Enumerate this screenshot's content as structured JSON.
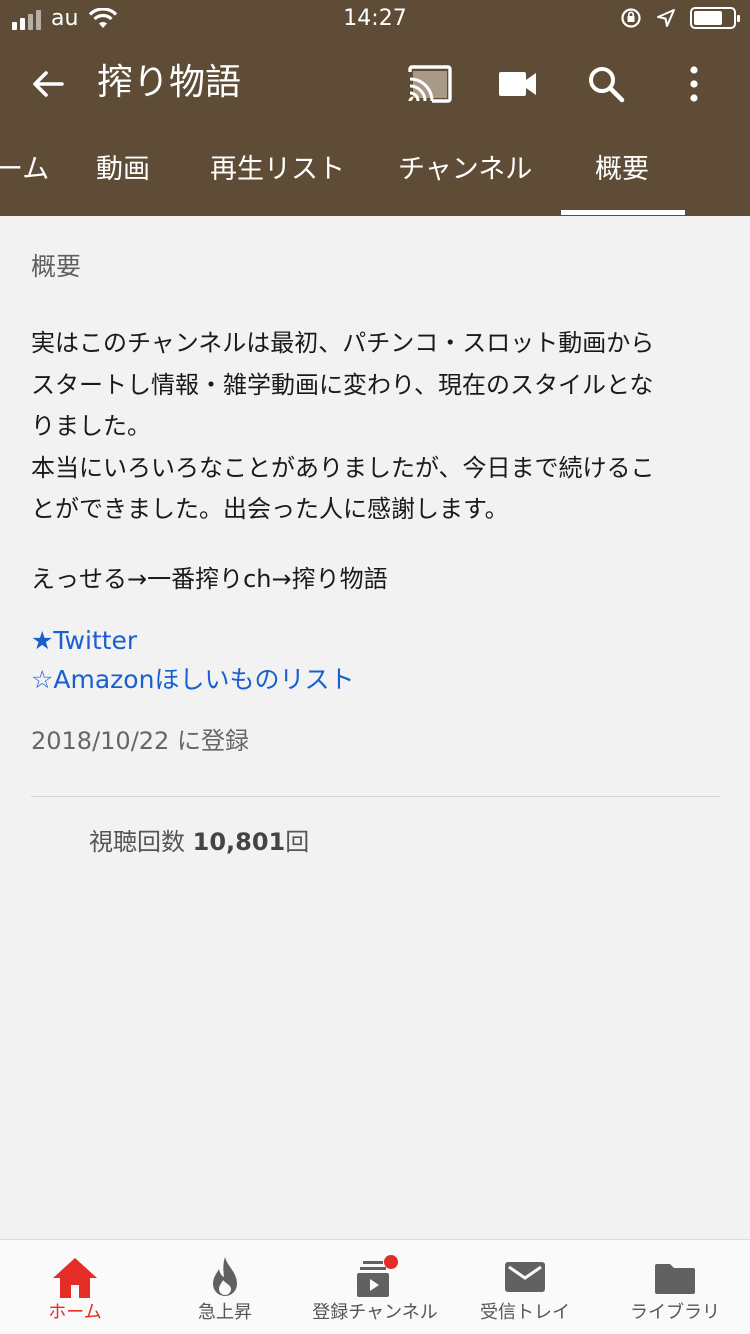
{
  "status_bar": {
    "carrier": "au",
    "time": "14:27"
  },
  "app_bar": {
    "title": "搾り物語"
  },
  "tabs": [
    {
      "label": "ーム"
    },
    {
      "label": "動画"
    },
    {
      "label": "再生リスト"
    },
    {
      "label": "チャンネル"
    },
    {
      "label": "概要"
    }
  ],
  "about": {
    "heading": "概要",
    "description": "実はこのチャンネルは最初、パチンコ・スロット動画から\nスタートし情報・雑学動画に変わり、現在のスタイルとな\nりました。\n本当にいろいろなことがありましたが、今日まで続けるこ\nとができました。出会った人に感謝します。",
    "history": "えっせる→一番搾りch→搾り物語",
    "links": [
      {
        "label": "★Twitter"
      },
      {
        "label": "☆Amazonほしいものリスト"
      }
    ],
    "joined": "2018/10/22 に登録",
    "views_label": "視聴回数",
    "views_value": "10,801",
    "views_unit": "回"
  },
  "bottom_nav": [
    {
      "label": "ホーム",
      "icon": "home-icon"
    },
    {
      "label": "急上昇",
      "icon": "flame-icon"
    },
    {
      "label": "登録チャンネル",
      "icon": "subscriptions-icon"
    },
    {
      "label": "受信トレイ",
      "icon": "mail-icon"
    },
    {
      "label": "ライブラリ",
      "icon": "folder-icon"
    }
  ],
  "colors": {
    "header_bg": "#5f4c36",
    "link": "#1a5fd0",
    "active_nav": "#e52d27"
  }
}
